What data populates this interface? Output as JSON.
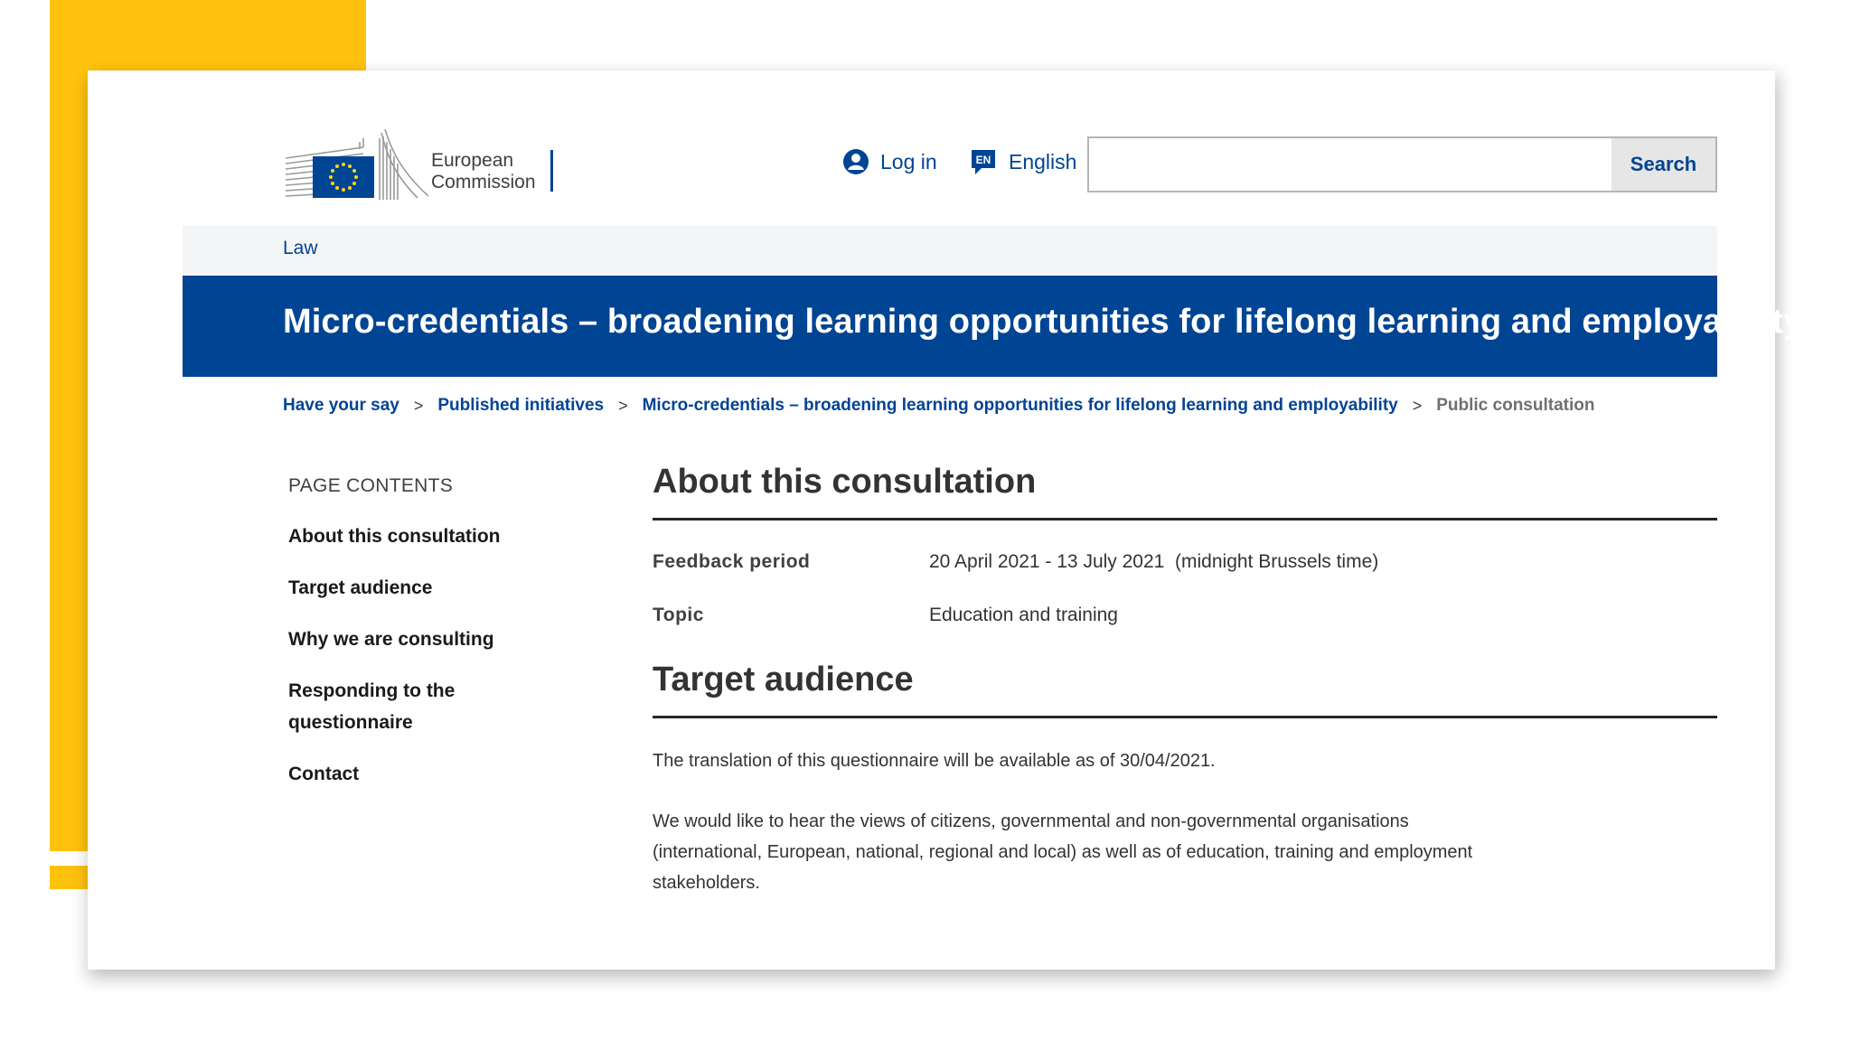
{
  "logo": {
    "line1": "European",
    "line2": "Commission",
    "icon": "eu-flag-icon"
  },
  "header": {
    "login_label": "Log in",
    "login_icon": "user-icon",
    "language_label": "English",
    "language_badge": "EN",
    "language_icon": "speech-bubble-icon",
    "search_placeholder": "",
    "search_button": "Search"
  },
  "site": {
    "name": "Law"
  },
  "page": {
    "title": "Micro-credentials – broadening learning opportunities for lifelong learning and employability"
  },
  "breadcrumb": {
    "items": [
      "Have your say",
      "Published initiatives",
      "Micro-credentials – broadening learning opportunities for lifelong learning and employability"
    ],
    "current": "Public consultation",
    "separator": ">"
  },
  "sidebar": {
    "heading": "PAGE CONTENTS",
    "items": [
      "About this consultation",
      "Target audience",
      "Why we are consulting",
      "Responding to the questionnaire",
      "Contact"
    ]
  },
  "main": {
    "about_heading": "About this consultation",
    "details": [
      {
        "label": "Feedback period",
        "value": "20 April 2021 - 13 July 2021  (midnight Brussels time)"
      },
      {
        "label": "Topic",
        "value": "Education and training"
      }
    ],
    "target_heading": "Target audience",
    "paragraphs": [
      "The translation of this questionnaire will be available as of 30/04/2021.",
      "We would like to hear the views of citizens, governmental and non-governmental organisations (international, European, national, regional and local) as well as of education, training and employment stakeholders."
    ]
  },
  "colors": {
    "accent": "#004494",
    "decoration": "#ffc20e",
    "site_bar": "#f4f5f7"
  }
}
